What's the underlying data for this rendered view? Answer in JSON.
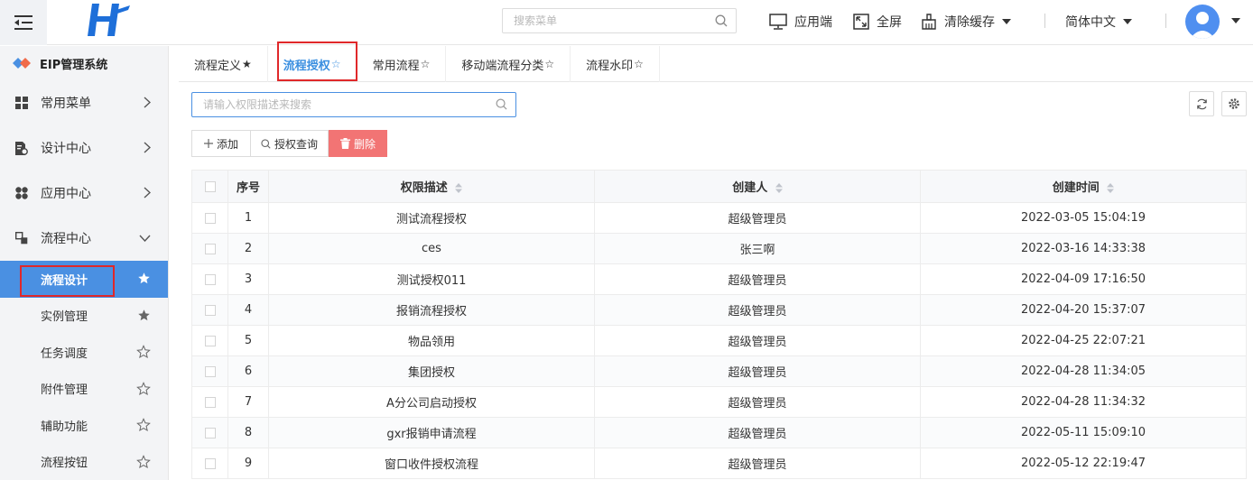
{
  "header": {
    "search_placeholder": "搜索菜单",
    "app_label": "应用端",
    "fullscreen_label": "全屏",
    "clear_cache_label": "清除缓存",
    "language_label": "简体中文"
  },
  "sidebar": {
    "brand": "EIP管理系统",
    "menus": [
      {
        "label": "常用菜单",
        "icon": "grid-icon"
      },
      {
        "label": "设计中心",
        "icon": "design-doc-icon"
      },
      {
        "label": "应用中心",
        "icon": "apps-icon"
      },
      {
        "label": "流程中心",
        "icon": "flow-icon"
      }
    ],
    "subitems": [
      {
        "label": "流程设计",
        "active": true
      },
      {
        "label": "实例管理",
        "starred": true
      },
      {
        "label": "任务调度",
        "starred": false
      },
      {
        "label": "附件管理",
        "starred": false
      },
      {
        "label": "辅助功能",
        "starred": false
      },
      {
        "label": "流程按钮",
        "starred": false
      }
    ]
  },
  "tabs": [
    {
      "label": "流程定义",
      "star": "★"
    },
    {
      "label": "流程授权",
      "star": "☆",
      "active": true
    },
    {
      "label": "常用流程",
      "star": "☆"
    },
    {
      "label": "移动端流程分类",
      "star": "☆"
    },
    {
      "label": "流程水印",
      "star": "☆"
    }
  ],
  "toolbar": {
    "search_placeholder": "请输入权限描述来搜索",
    "add_label": "添加",
    "query_label": "授权查询",
    "delete_label": "删除"
  },
  "table": {
    "headers": [
      "序号",
      "权限描述",
      "创建人",
      "创建时间"
    ],
    "rows": [
      {
        "no": "1",
        "desc": "测试流程授权",
        "creator": "超级管理员",
        "time": "2022-03-05 15:04:19"
      },
      {
        "no": "2",
        "desc": "ces",
        "creator": "张三啊",
        "time": "2022-03-16 14:33:38"
      },
      {
        "no": "3",
        "desc": "测试授权011",
        "creator": "超级管理员",
        "time": "2022-04-09 17:16:50"
      },
      {
        "no": "4",
        "desc": "报销流程授权",
        "creator": "超级管理员",
        "time": "2022-04-20 15:37:07"
      },
      {
        "no": "5",
        "desc": "物品领用",
        "creator": "超级管理员",
        "time": "2022-04-25 22:07:21"
      },
      {
        "no": "6",
        "desc": "集团授权",
        "creator": "超级管理员",
        "time": "2022-04-28 11:34:05"
      },
      {
        "no": "7",
        "desc": "A分公司启动授权",
        "creator": "超级管理员",
        "time": "2022-04-28 11:34:32"
      },
      {
        "no": "8",
        "desc": "gxr报销申请流程",
        "creator": "超级管理员",
        "time": "2022-05-11 15:09:10"
      },
      {
        "no": "9",
        "desc": "窗口收件授权流程",
        "creator": "超级管理员",
        "time": "2022-05-12 22:19:47"
      }
    ]
  },
  "colors": {
    "accent": "#4a90e2",
    "link": "#3b8fe0",
    "danger": "#f27474",
    "highlight": "#e0282a"
  }
}
